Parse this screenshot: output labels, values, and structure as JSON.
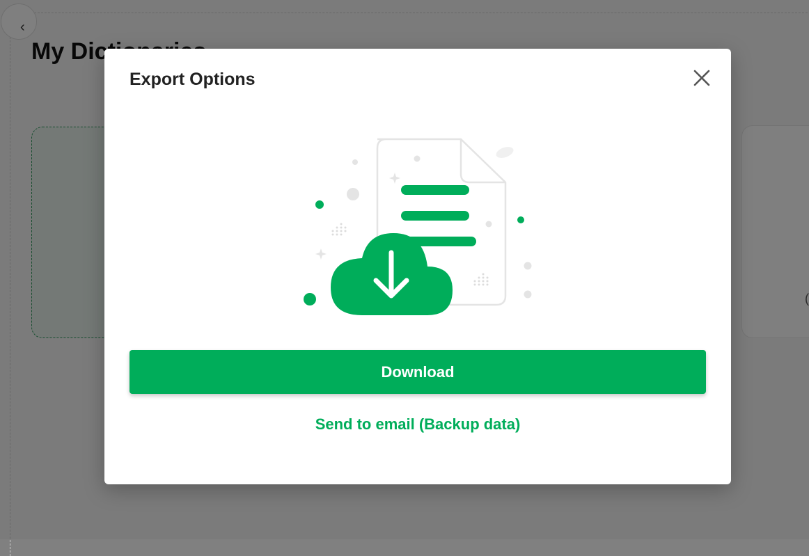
{
  "background": {
    "page_title": "My Dictionaries",
    "back_icon": "chevron-left-icon",
    "partial_card_glyph": "("
  },
  "modal": {
    "title": "Export Options",
    "close_icon": "close-icon",
    "illustration_icon": "cloud-download-document-icon",
    "download_label": "Download",
    "email_label": "Send to email (Backup data)"
  },
  "colors": {
    "accent": "#00ad5a",
    "overlay": "rgba(0,0,0,0.5)"
  }
}
